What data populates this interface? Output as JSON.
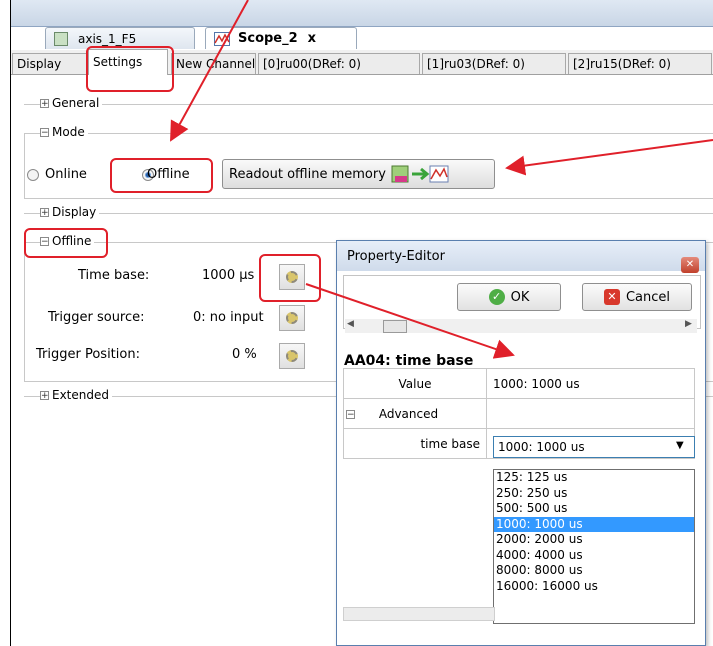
{
  "colors": {
    "annotation_red": "#e0202a",
    "selection_blue": "#3399ff",
    "accent": "#5a7fae"
  },
  "doc_tabs": [
    {
      "label": "axis_1_F5",
      "icon": "axis-icon"
    },
    {
      "label": "Scope_2",
      "icon": "scope-icon",
      "close": "x"
    }
  ],
  "sub_tabs": [
    "Display",
    "Settings",
    "New Channel",
    "[0]ru00(DRef: 0)",
    "[1]ru03(DRef: 0)",
    "[2]ru15(DRef: 0)"
  ],
  "sections": {
    "general": "General",
    "mode": "Mode",
    "display": "Display",
    "offline": "Offline",
    "extended": "Extended"
  },
  "mode": {
    "online_label": "Online",
    "offline_label": "Offline",
    "readout_button": "Readout offline memory",
    "selected": "Offline"
  },
  "offline": {
    "time_base_label": "Time base:",
    "time_base_value": "1000 µs",
    "trigger_source_label": "Trigger source:",
    "trigger_source_value": "0: no input",
    "trigger_position_label": "Trigger Position:",
    "trigger_position_value": "0 %"
  },
  "property_editor": {
    "title": "Property-Editor",
    "close": "✕",
    "ok_label": "OK",
    "cancel_label": "Cancel",
    "heading": "AA04: time base",
    "rows": {
      "value_label": "Value",
      "value": "1000: 1000 us",
      "advanced_label": "Advanced",
      "time_base_label": "time base",
      "time_base_value": "1000: 1000 us"
    },
    "options": [
      "125: 125 us",
      "250: 250 us",
      "500: 500 us",
      "1000: 1000 us",
      "2000: 2000 us",
      "4000: 4000 us",
      "8000: 8000 us",
      "16000: 16000 us"
    ],
    "selected_option": "1000: 1000 us"
  }
}
